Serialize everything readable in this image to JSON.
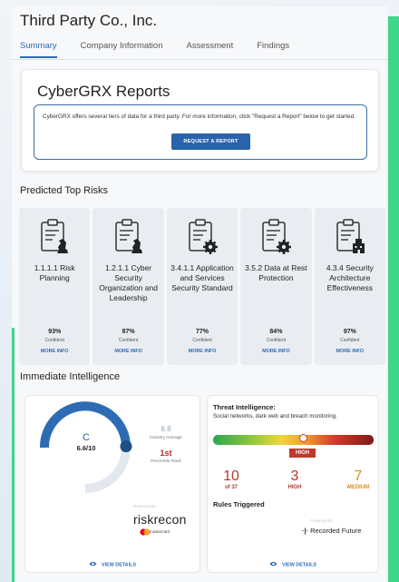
{
  "company": {
    "name": "Third Party Co., Inc."
  },
  "tabs": [
    {
      "label": "Summary",
      "active": true
    },
    {
      "label": "Company Information",
      "active": false
    },
    {
      "label": "Assessment",
      "active": false
    },
    {
      "label": "Findings",
      "active": false
    }
  ],
  "reports": {
    "title": "CyberGRX Reports",
    "description": "CyberGRX offers several tiers of data for a third party. For more information, click \"Request a Report\" below to get started.",
    "button": "REQUEST A REPORT"
  },
  "risks": {
    "title": "Predicted Top Risks",
    "items": [
      {
        "name": "1.1.1.1 Risk Planning",
        "confidence": "93%",
        "confidence_label": "Confident",
        "more": "MORE INFO",
        "icon": "clipboard-chess-icon"
      },
      {
        "name": "1.2.1.1 Cyber Security Organization and Leadership",
        "confidence": "87%",
        "confidence_label": "Confident",
        "more": "MORE INFO",
        "icon": "clipboard-chess-icon"
      },
      {
        "name": "3.4.1.1 Application and Services Security Standard",
        "confidence": "77%",
        "confidence_label": "Confident",
        "more": "MORE INFO",
        "icon": "clipboard-gear-icon"
      },
      {
        "name": "3.5.2 Data at Rest Protection",
        "confidence": "84%",
        "confidence_label": "Confident",
        "more": "MORE INFO",
        "icon": "clipboard-gear-icon"
      },
      {
        "name": "4.3.4 Security Architecture Effectiveness",
        "confidence": "97%",
        "confidence_label": "Confident",
        "more": "MORE INFO",
        "icon": "clipboard-building-icon"
      }
    ]
  },
  "intel": {
    "title": "Immediate Intelligence",
    "riskrecon": {
      "grade": "C",
      "score": "6.6/10",
      "score_fraction": 0.66,
      "industry_avg": "8.8",
      "industry_avg_label": "Industry Average",
      "percentile": "1st",
      "percentile_label": "Percentile Rank",
      "powered_by": "Powered By",
      "logo": "riskrecon",
      "logo_sub": "mastercard",
      "view": "VIEW DETAILS"
    },
    "threat": {
      "title": "Threat Intelligence:",
      "subtitle": "Social networks, dark web and breach monitoring.",
      "level": "HIGH",
      "stats": [
        {
          "value": "10",
          "label": "of 37",
          "color": "#b03a2e"
        },
        {
          "value": "3",
          "label": "HIGH",
          "color": "#b03a2e"
        },
        {
          "value": "7",
          "label": "MEDIUM",
          "color": "#e08a1e"
        }
      ],
      "rules": "Rules Triggered",
      "powered_by": "Powered By",
      "logo": "Recorded Future",
      "view": "VIEW DETAILS"
    }
  },
  "colors": {
    "accent": "#2d6cb5",
    "green": "#3fd68a",
    "danger": "#b03a2e"
  }
}
